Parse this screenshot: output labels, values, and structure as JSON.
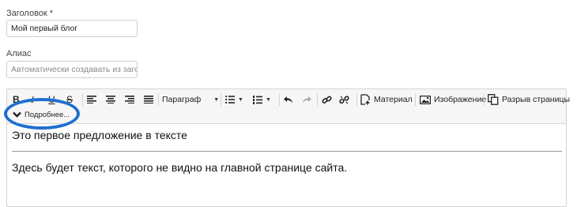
{
  "form": {
    "title_label": "Заголовок *",
    "title_value": "Мой первый блог",
    "alias_label": "Алиас",
    "alias_placeholder": "Автоматически создавать из заголовка"
  },
  "toolbar": {
    "bold": "B",
    "italic": "I",
    "underline": "U",
    "strike": "S",
    "paragraph": "Параграф",
    "material": "Материал",
    "image": "Изображение",
    "page_break": "Разрыв страницы",
    "read_more": "Подробнее..."
  },
  "content": {
    "intro": "Это первое предложение в тексте",
    "rest": "Здесь будет текст, которого не видно на главной странице сайта."
  },
  "colors": {
    "highlight": "#1f6fcf"
  }
}
